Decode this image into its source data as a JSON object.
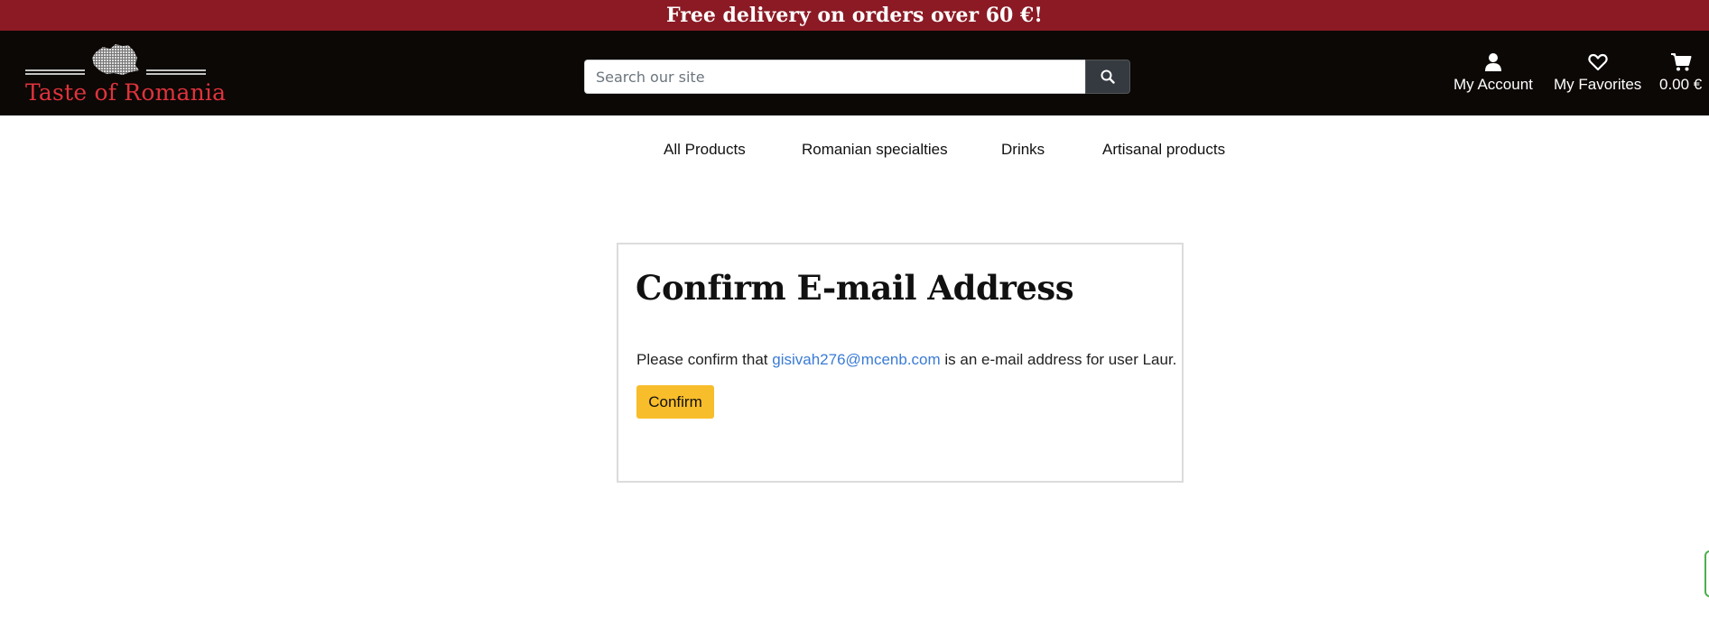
{
  "promo": {
    "text": "Free delivery on orders over 60 €!"
  },
  "brand": {
    "name": "Taste of Romania",
    "color": "#e0333c"
  },
  "search": {
    "placeholder": "Search our site",
    "value": "",
    "icon": "search-icon"
  },
  "header_links": {
    "account": {
      "label": "My Account",
      "icon": "user-icon"
    },
    "favorites": {
      "label": "My Favorites",
      "icon": "heart-icon"
    },
    "cart": {
      "label": "0.00 €",
      "icon": "cart-icon"
    }
  },
  "nav": {
    "items": [
      {
        "label": "All Products"
      },
      {
        "label": "Romanian specialties"
      },
      {
        "label": "Drinks"
      },
      {
        "label": "Artisanal products"
      }
    ]
  },
  "card": {
    "title": "Confirm E-mail Address",
    "message_prefix": "Please confirm that ",
    "email": "gisivah276@mcenb.com",
    "message_suffix": " is an e-mail address for user Laur.",
    "confirm_label": "Confirm"
  },
  "colors": {
    "promo_bg": "#8b1a24",
    "header_bg": "#0c0806",
    "accent_button": "#f8bd2a",
    "link": "#3a7bd5"
  }
}
